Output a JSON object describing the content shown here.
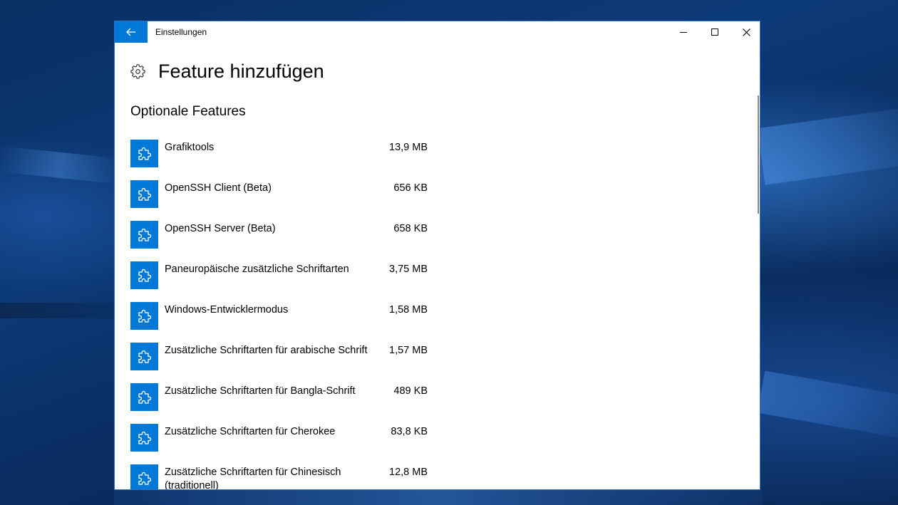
{
  "window": {
    "title": "Einstellungen",
    "accent_color": "#0078d7"
  },
  "header": {
    "title": "Feature hinzufügen",
    "icon": "gear-icon"
  },
  "section": {
    "title": "Optionale Features"
  },
  "features": [
    {
      "name": "Grafiktools",
      "size": "13,9 MB",
      "icon": "puzzle-icon"
    },
    {
      "name": "OpenSSH Client (Beta)",
      "size": "656 KB",
      "icon": "puzzle-icon"
    },
    {
      "name": "OpenSSH Server (Beta)",
      "size": "658 KB",
      "icon": "puzzle-icon"
    },
    {
      "name": "Paneuropäische zusätzliche Schriftarten",
      "size": "3,75 MB",
      "icon": "puzzle-icon"
    },
    {
      "name": "Windows-Entwicklermodus",
      "size": "1,58 MB",
      "icon": "puzzle-icon"
    },
    {
      "name": "Zusätzliche Schriftarten für arabische Schrift",
      "size": "1,57 MB",
      "icon": "puzzle-icon"
    },
    {
      "name": "Zusätzliche Schriftarten für Bangla-Schrift",
      "size": "489 KB",
      "icon": "puzzle-icon"
    },
    {
      "name": "Zusätzliche Schriftarten für Cherokee",
      "size": "83,8 KB",
      "icon": "puzzle-icon"
    },
    {
      "name": "Zusätzliche Schriftarten für Chinesisch (traditionell)",
      "size": "12,8 MB",
      "icon": "puzzle-icon"
    }
  ]
}
